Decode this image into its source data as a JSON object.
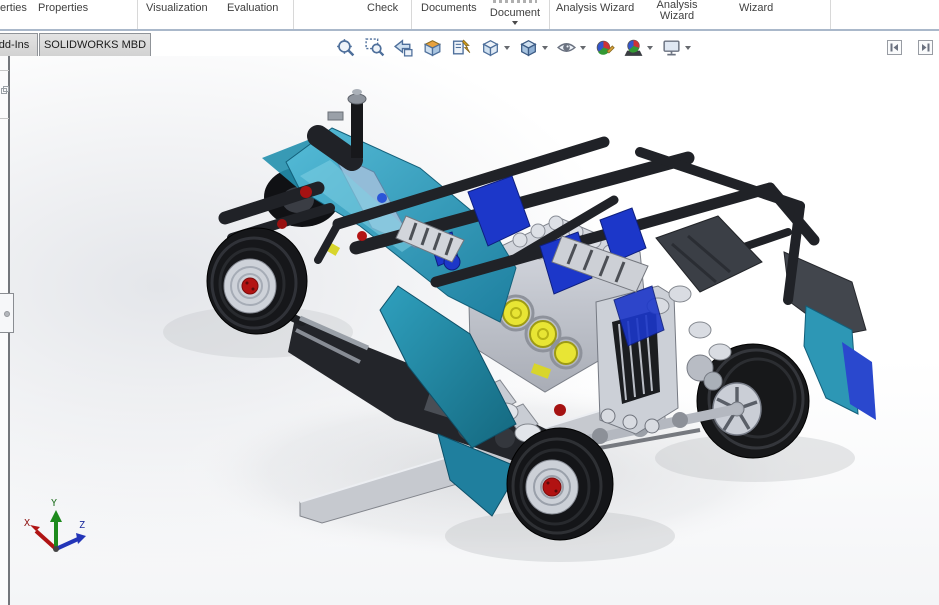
{
  "app": {
    "name": "SOLIDWORKS",
    "viewport_note": "LEGO Technic hot rod 3D model"
  },
  "ribbon": {
    "items": [
      {
        "label": "erties"
      },
      {
        "label": "Properties"
      },
      {
        "label": "Visualization"
      },
      {
        "label": "Evaluation"
      },
      {
        "label": "Check"
      },
      {
        "label": "Documents"
      },
      {
        "label": "Document"
      },
      {
        "label": "Analysis Wizard"
      },
      {
        "label": "Analysis Wizard"
      },
      {
        "label": "Wizard"
      }
    ]
  },
  "tabs": [
    {
      "label": "dd-Ins"
    },
    {
      "label": "SOLIDWORKS MBD"
    }
  ],
  "viewport_toolbar": {
    "tools": [
      {
        "name": "Zoom to Fit",
        "has_dropdown": false
      },
      {
        "name": "Zoom to Area",
        "has_dropdown": false
      },
      {
        "name": "Previous View",
        "has_dropdown": false
      },
      {
        "name": "Section View",
        "has_dropdown": false
      },
      {
        "name": "Dynamic Annotation Views",
        "has_dropdown": false
      },
      {
        "name": "View Orientation",
        "has_dropdown": true
      },
      {
        "name": "Display Style",
        "has_dropdown": true
      },
      {
        "name": "Hide/Show Items",
        "has_dropdown": true
      },
      {
        "name": "Edit Appearance",
        "has_dropdown": false
      },
      {
        "name": "Apply Scene",
        "has_dropdown": true
      },
      {
        "name": "View Settings",
        "has_dropdown": true
      }
    ]
  },
  "pane_buttons": [
    {
      "name": "Collapse pane left"
    },
    {
      "name": "Collapse pane right"
    }
  ],
  "triad": {
    "x": "X",
    "y": "Y",
    "z": "Z"
  },
  "model": {
    "body_color": "#2D9CBA",
    "frame_color": "#1F2126",
    "engine_color": "#C2C6CF",
    "accent_blue": "#1C37C9",
    "accent_yellow": "#E8E534",
    "accent_red": "#B11212",
    "tire_color": "#17181A"
  }
}
